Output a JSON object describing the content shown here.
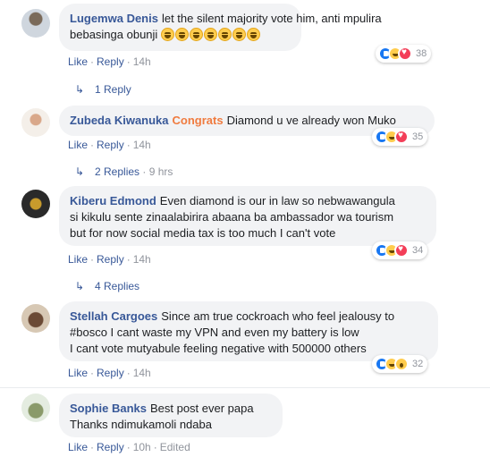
{
  "comments": [
    {
      "author": "Lugemwa Denis",
      "lines": [
        "let the silent majority vote him, anti mpulira",
        "bebasinga obunji"
      ],
      "emojis": 7,
      "reactions": [
        "like",
        "haha",
        "love"
      ],
      "reaction_count": "38",
      "actions": {
        "like": "Like",
        "reply": "Reply",
        "time": "14h"
      },
      "replies": "1 Reply",
      "replies_time": ""
    },
    {
      "author": "Zubeda Kiwanuka",
      "highlight": "Congrats",
      "lines": [
        "Diamond u ve already won Muko"
      ],
      "reactions": [
        "like",
        "haha",
        "love"
      ],
      "reaction_count": "35",
      "actions": {
        "like": "Like",
        "reply": "Reply",
        "time": "14h"
      },
      "replies": "2 Replies",
      "replies_time": "9 hrs"
    },
    {
      "author": "Kiberu Edmond",
      "lines": [
        "Even diamond is our in law so nebwawangula",
        "si kikulu sente zinaalabirira abaana ba ambassador wa tourism",
        "but for now social media tax is too much I can't vote"
      ],
      "reactions": [
        "like",
        "haha",
        "love"
      ],
      "reaction_count": "34",
      "actions": {
        "like": "Like",
        "reply": "Reply",
        "time": "14h"
      },
      "replies": "4 Replies",
      "replies_time": ""
    },
    {
      "author": "Stellah Cargoes",
      "lines": [
        "Since am true cockroach who feel jealousy to",
        "#bosco I cant waste my VPN and even my battery is low",
        "I cant vote mutyabule feeling negative with 500000 others"
      ],
      "reactions": [
        "like",
        "haha",
        "wow"
      ],
      "reaction_count": "32",
      "actions": {
        "like": "Like",
        "reply": "Reply",
        "time": "14h"
      }
    },
    {
      "author": "Sophie Banks",
      "lines": [
        "Best post ever papa",
        "Thanks ndimukamoli ndaba"
      ],
      "actions": {
        "like": "Like",
        "reply": "Reply",
        "time": "10h",
        "edited": "Edited"
      }
    }
  ],
  "colors": {
    "link": "#385898",
    "meta": "#90949c",
    "bubble": "#f2f3f5",
    "highlight": "#f07b3f"
  }
}
